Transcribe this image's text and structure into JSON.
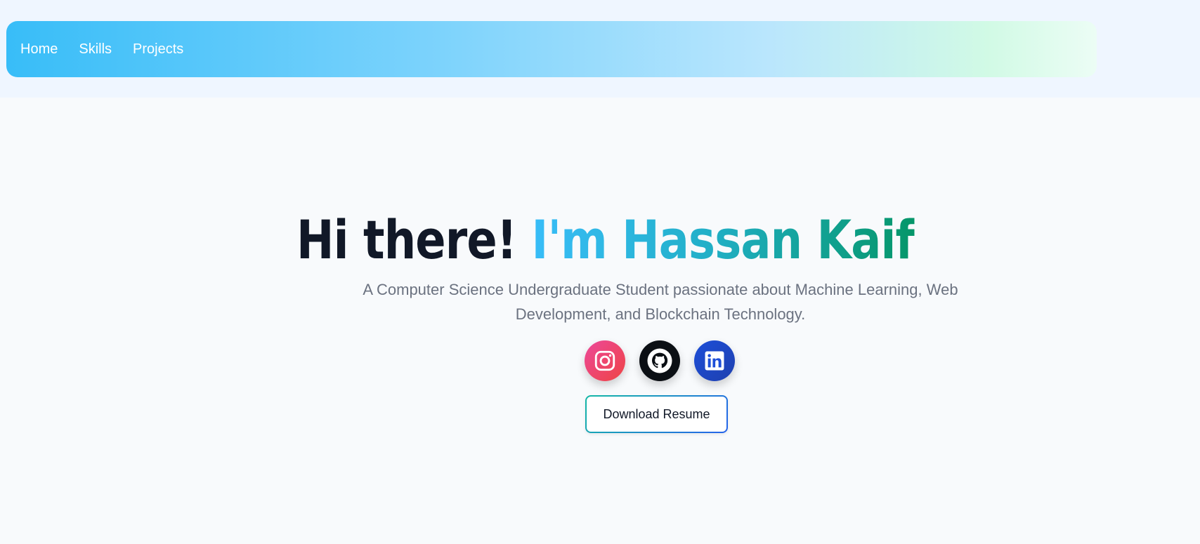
{
  "nav": {
    "items": [
      {
        "label": "Home"
      },
      {
        "label": "Skills"
      },
      {
        "label": "Projects"
      }
    ]
  },
  "hero": {
    "greeting": "Hi there! ",
    "name": "I'm Hassan Kaif",
    "subtitle": "A Computer Science Undergraduate Student passionate about Machine Learning, Web Development, and Blockchain Technology.",
    "download_label": "Download Resume"
  },
  "socials": [
    {
      "icon": "instagram-icon"
    },
    {
      "icon": "github-icon"
    },
    {
      "icon": "linkedin-icon"
    }
  ],
  "colors": {
    "page_bg": "#f8fafc",
    "header_bg": "#eff6ff",
    "nav_gradient_start": "#38bdf8",
    "nav_gradient_end": "#ecfdf5",
    "title_dark": "#111827",
    "name_gradient_start": "#38bdf8",
    "name_gradient_end": "#059669",
    "subtitle": "#6b7280"
  }
}
